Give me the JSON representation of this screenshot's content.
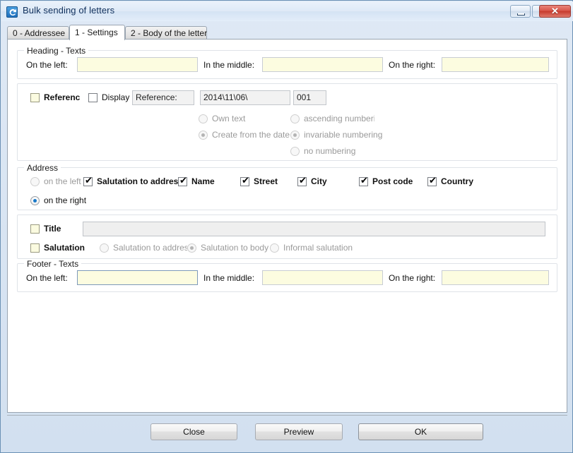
{
  "window": {
    "title": "Bulk sending of letters",
    "icon": "app-swirl-icon",
    "controls": {
      "minimize": "minimize-icon",
      "maximize": "maximize-icon",
      "close": "✕"
    }
  },
  "tabs": [
    {
      "label": "0 - Addressee",
      "active": false
    },
    {
      "label": "1 - Settings",
      "active": true
    },
    {
      "label": "2 - Body of the letter",
      "active": false
    }
  ],
  "heading_group": {
    "title": "Heading - Texts",
    "left_label": "On the left:",
    "left_value": "",
    "middle_label": "In the middle:",
    "middle_value": "",
    "right_label": "On the right:",
    "right_value": ""
  },
  "reference_group": {
    "reference_checkbox_label": "Referenc",
    "reference_checked": false,
    "display_checkbox_label": "Display",
    "display_checked": false,
    "prefix_value": "Reference:",
    "date_value": "2014\\11\\06\\",
    "number_value": "001",
    "text_options": [
      {
        "label": "Own text",
        "selected": false
      },
      {
        "label": "Create from the date",
        "selected": true
      }
    ],
    "numbering_options": [
      {
        "label": "ascending numbering",
        "selected": false
      },
      {
        "label": "invariable numbering",
        "selected": true
      },
      {
        "label": "no numbering",
        "selected": false
      }
    ]
  },
  "address_group": {
    "title": "Address",
    "position_options": [
      {
        "label": "on the left",
        "selected": false
      },
      {
        "label": "on the right",
        "selected": true
      }
    ],
    "fields": [
      {
        "label": "Salutation to address",
        "checked": true
      },
      {
        "label": "Name",
        "checked": true
      },
      {
        "label": "Street",
        "checked": true
      },
      {
        "label": "City",
        "checked": true
      },
      {
        "label": "Post code",
        "checked": true
      },
      {
        "label": "Country",
        "checked": true
      }
    ]
  },
  "title_row": {
    "checkbox_label": "Title",
    "checked": false,
    "value": ""
  },
  "salutation_row": {
    "checkbox_label": "Salutation",
    "checked": false,
    "options": [
      {
        "label": "Salutation to address",
        "selected": false
      },
      {
        "label": "Salutation to body",
        "selected": true
      },
      {
        "label": "Informal salutation",
        "selected": false
      }
    ]
  },
  "footer_group": {
    "title": "Footer - Texts",
    "left_label": "On the left:",
    "left_value": "",
    "middle_label": "In the middle:",
    "middle_value": "",
    "right_label": "On the right:",
    "right_value": ""
  },
  "buttons": {
    "close": "Close",
    "preview": "Preview",
    "ok": "OK"
  },
  "colors": {
    "input_bg": "#fcfce0",
    "accent": "#1878c8",
    "window_border": "#6b91b5"
  }
}
